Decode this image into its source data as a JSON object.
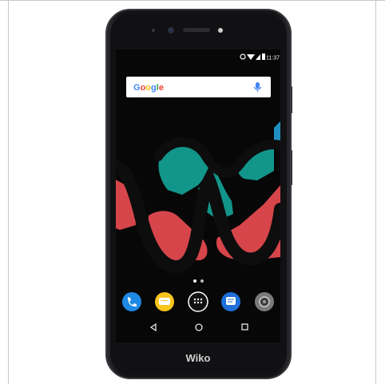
{
  "device": {
    "brand_logo": "Wiko",
    "body_color": "#17171a",
    "frame_color": "#3a3a3e"
  },
  "status_bar": {
    "time": "11:37",
    "icons": [
      "alarm-icon",
      "wifi-icon",
      "cell-signal-icon",
      "battery-icon"
    ]
  },
  "search_widget": {
    "logo_text": "Google",
    "mic_icon": "mic-icon",
    "logo_colors": [
      "#4285F4",
      "#EA4335",
      "#FBBC05",
      "#4285F4",
      "#34A853",
      "#EA4335"
    ],
    "mic_color": "#4285F4"
  },
  "wallpaper": {
    "colors": {
      "teal": "#12958a",
      "red": "#d6454a",
      "blue": "#1f8fc1",
      "outline": "#0d0d0d"
    }
  },
  "page_indicator": {
    "pages": 2,
    "active": 0
  },
  "dock": [
    {
      "name": "phone-app-icon",
      "color": "#1e88e5"
    },
    {
      "name": "messages-app-icon",
      "color": "#f9c51d"
    },
    {
      "name": "app-drawer-icon",
      "color": "#111111"
    },
    {
      "name": "sms-app-icon",
      "color": "#1e6fd9"
    },
    {
      "name": "camera-app-icon",
      "color": "#7a7a7a"
    }
  ],
  "nav_bar": [
    "back-icon",
    "home-icon",
    "recents-icon"
  ]
}
